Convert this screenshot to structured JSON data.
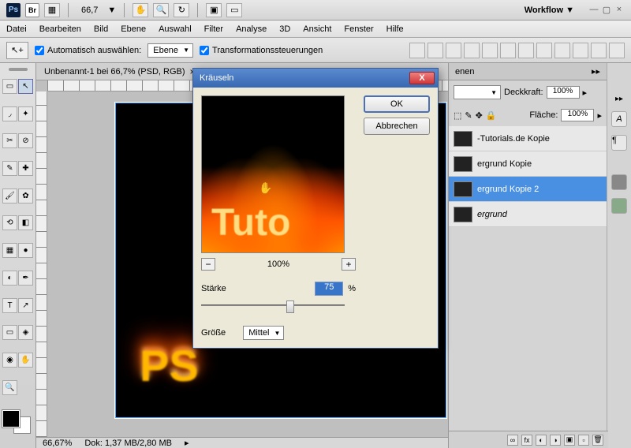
{
  "topbar": {
    "zoom_label": "66,7",
    "workflow_label": "Workflow ▼"
  },
  "menu": {
    "datei": "Datei",
    "bearbeiten": "Bearbeiten",
    "bild": "Bild",
    "ebene": "Ebene",
    "auswahl": "Auswahl",
    "filter": "Filter",
    "analyse": "Analyse",
    "d3": "3D",
    "ansicht": "Ansicht",
    "fenster": "Fenster",
    "hilfe": "Hilfe"
  },
  "options": {
    "auto_select": "Automatisch auswählen:",
    "layer_select": "Ebene",
    "transform": "Transformationssteuerungen"
  },
  "doc": {
    "title": "Unbenannt-1 bei 66,7% (PSD, RGB)",
    "close": "×",
    "fire_text": "PS"
  },
  "status": {
    "zoom": "66,67%",
    "dok": "Dok: 1,37 MB/2,80 MB"
  },
  "dialog": {
    "title": "Kräuseln",
    "ok": "OK",
    "cancel": "Abbrechen",
    "zoom": "100%",
    "strength_label": "Stärke",
    "strength_value": "75",
    "strength_unit": "%",
    "size_label": "Größe",
    "size_value": "Mittel",
    "preview_text": "Tuto"
  },
  "panels": {
    "layers_tab": "enen",
    "opacity_label": "Deckkraft:",
    "opacity_value": "100%",
    "fill_label": "Fläche:",
    "fill_value": "100%"
  },
  "layers": [
    {
      "name": "-Tutorials.de Kopie",
      "sel": false
    },
    {
      "name": "ergrund Kopie",
      "sel": false
    },
    {
      "name": "ergrund Kopie 2",
      "sel": true
    },
    {
      "name": "ergrund",
      "sel": false,
      "italic": true
    }
  ]
}
